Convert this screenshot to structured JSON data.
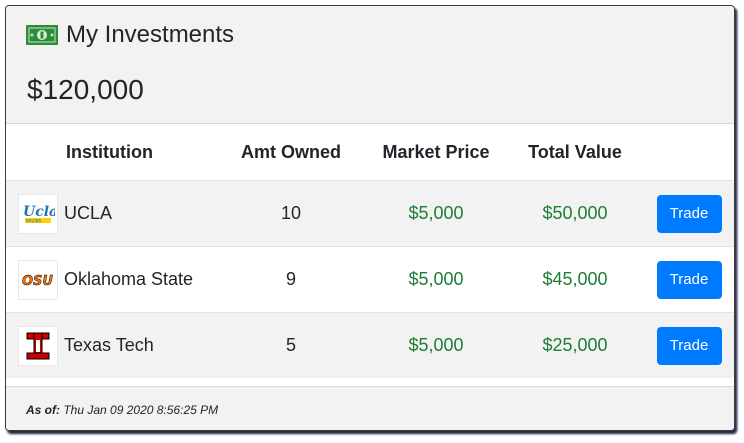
{
  "header": {
    "icon": "money-bill-icon",
    "title": "My Investments",
    "total": "$120,000"
  },
  "table": {
    "columns": [
      "Institution",
      "Amt Owned",
      "Market Price",
      "Total Value",
      ""
    ],
    "rows": [
      {
        "institution": "UCLA",
        "logo": "ucla-logo",
        "amt_owned": "10",
        "market_price": "$5,000",
        "total_value": "$50,000",
        "action": "Trade"
      },
      {
        "institution": "Oklahoma State",
        "logo": "osu-logo",
        "amt_owned": "9",
        "market_price": "$5,000",
        "total_value": "$45,000",
        "action": "Trade"
      },
      {
        "institution": "Texas Tech",
        "logo": "texas-tech-logo",
        "amt_owned": "5",
        "market_price": "$5,000",
        "total_value": "$25,000",
        "action": "Trade"
      }
    ]
  },
  "footer": {
    "as_of_label": "As of:",
    "as_of_value": "Thu Jan 09 2020 8:56:25 PM"
  },
  "colors": {
    "value_green": "#1e7e34",
    "button_blue": "#007bff",
    "money_icon_green": "#2e8b3a"
  }
}
